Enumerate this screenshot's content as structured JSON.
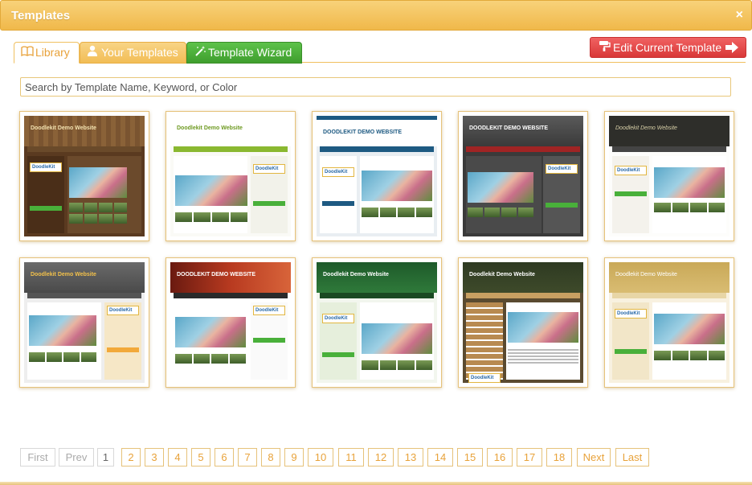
{
  "dialog": {
    "title": "Templates",
    "close_label": "×"
  },
  "tabs": [
    {
      "label": "Library",
      "icon": "book-icon",
      "active": true
    },
    {
      "label": "Your Templates",
      "icon": "user-icon",
      "active": false
    },
    {
      "label": "Template Wizard",
      "icon": "magic-wand-icon",
      "active": false
    }
  ],
  "edit_button": {
    "label": "Edit Current Template",
    "icon_left": "paint-roller-icon",
    "icon_right": "arrow-right-icon"
  },
  "search": {
    "placeholder": "Search by Template Name, Keyword, or Color",
    "value": ""
  },
  "templates": [
    {
      "site_name": "Doodlekit Demo Website",
      "theme": "wood"
    },
    {
      "site_name": "Doodlekit Demo Website",
      "theme": "light-green"
    },
    {
      "site_name": "DOODLEKIT DEMO WEBSITE",
      "theme": "blue"
    },
    {
      "site_name": "DOODLEKIT DEMO WEBSITE",
      "theme": "dark-red"
    },
    {
      "site_name": "Doodlekit Demo Website",
      "theme": "chalkboard"
    },
    {
      "site_name": "Doodlekit Demo Website",
      "theme": "gray-orange"
    },
    {
      "site_name": "DOODLEKIT DEMO WEBSITE",
      "theme": "red-sunset"
    },
    {
      "site_name": "Doodlekit Demo Website",
      "theme": "dark-green"
    },
    {
      "site_name": "Doodlekit Demo Website",
      "theme": "forest-wood"
    },
    {
      "site_name": "Doodlekit Demo Website",
      "theme": "gold"
    }
  ],
  "pagination": {
    "first": "First",
    "prev": "Prev",
    "pages": [
      "1",
      "2",
      "3",
      "4",
      "5",
      "6",
      "7",
      "8",
      "9",
      "10",
      "11",
      "12",
      "13",
      "14",
      "15",
      "16",
      "17",
      "18"
    ],
    "current": "1",
    "next": "Next",
    "last": "Last"
  },
  "colors": {
    "accent_orange": "#f0b84a",
    "wizard_green": "#3f9e2e",
    "edit_red": "#d93838"
  }
}
